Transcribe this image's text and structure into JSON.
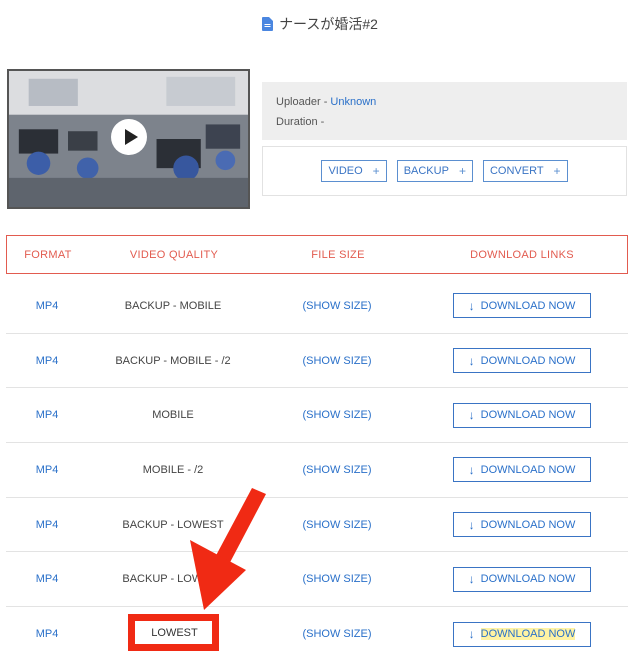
{
  "page": {
    "title": "ナースが婚活#2"
  },
  "info": {
    "uploader_label": "Uploader - ",
    "uploader_value": "Unknown",
    "duration_label": "Duration - "
  },
  "actions": [
    {
      "label": "VIDEO",
      "icon": "plus-icon"
    },
    {
      "label": "BACKUP",
      "icon": "plus-icon"
    },
    {
      "label": "CONVERT",
      "icon": "plus-icon"
    }
  ],
  "table": {
    "headers": {
      "format": "FORMAT",
      "quality": "VIDEO QUALITY",
      "size": "FILE SIZE",
      "links": "DOWNLOAD LINKS"
    },
    "rows": [
      {
        "format": "MP4",
        "quality": "BACKUP - MOBILE",
        "size": "(SHOW SIZE)",
        "link": "DOWNLOAD NOW"
      },
      {
        "format": "MP4",
        "quality": "BACKUP - MOBILE - /2",
        "size": "(SHOW SIZE)",
        "link": "DOWNLOAD NOW"
      },
      {
        "format": "MP4",
        "quality": "MOBILE",
        "size": "(SHOW SIZE)",
        "link": "DOWNLOAD NOW"
      },
      {
        "format": "MP4",
        "quality": "MOBILE - /2",
        "size": "(SHOW SIZE)",
        "link": "DOWNLOAD NOW"
      },
      {
        "format": "MP4",
        "quality": "BACKUP - LOWEST",
        "size": "(SHOW SIZE)",
        "link": "DOWNLOAD NOW"
      },
      {
        "format": "MP4",
        "quality": "BACKUP - LOWEST",
        "size": "(SHOW SIZE)",
        "link": "DOWNLOAD NOW"
      },
      {
        "format": "MP4",
        "quality": "LOWEST",
        "size": "(SHOW SIZE)",
        "link": "DOWNLOAD NOW"
      }
    ]
  },
  "colors": {
    "accent": "#2a70c9",
    "header_red": "#e25b4f",
    "annotation_red": "#f02a14"
  }
}
